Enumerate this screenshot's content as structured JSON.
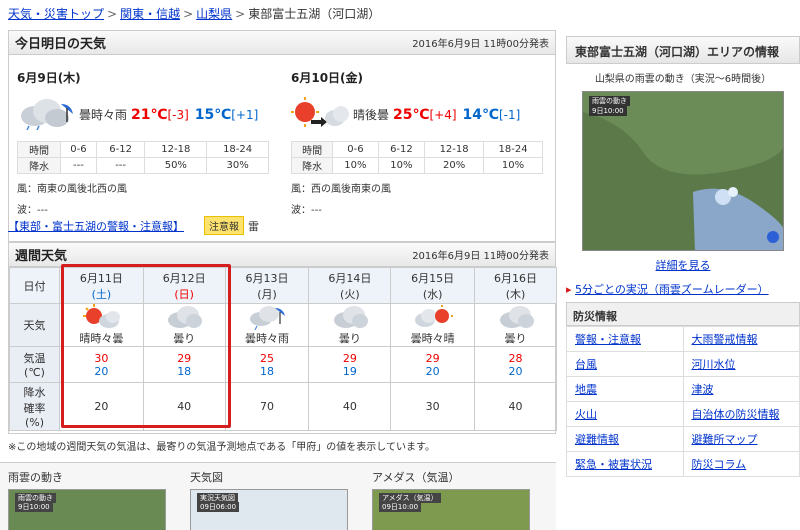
{
  "breadcrumb": {
    "items": [
      "天気・災害トップ",
      "関東・信越",
      "山梨県"
    ],
    "current": "東部富士五湖（河口湖）",
    "sep": ">"
  },
  "today_panel": {
    "title": "今日明日の天気",
    "issued": "2016年6月9日 11時00分発表",
    "days": [
      {
        "date": "6月9日(木)",
        "icon": "rain-cloud-icon",
        "weather": "曇時々雨",
        "high": "21℃",
        "high_diff": "[-3]",
        "low": "15℃",
        "low_diff": "[+1]",
        "rain_labels": [
          "時間",
          "0-6",
          "6-12",
          "12-18",
          "18-24"
        ],
        "rain_values": [
          "降水",
          "---",
          "---",
          "50%",
          "30%"
        ],
        "wind": "風：南東の風後北西の風",
        "wave": "波：---"
      },
      {
        "date": "6月10日(金)",
        "icon": "sun-then-cloud-icon",
        "weather": "晴後曇",
        "high": "25℃",
        "high_diff": "[+4]",
        "low": "14℃",
        "low_diff": "[-1]",
        "rain_labels": [
          "時間",
          "0-6",
          "6-12",
          "12-18",
          "18-24"
        ],
        "rain_values": [
          "降水",
          "10%",
          "10%",
          "20%",
          "10%"
        ],
        "wind": "風：西の風後南東の風",
        "wave": "波：---"
      }
    ],
    "warning_link": "【東部・富士五湖の警報・注意報】",
    "warning_badge": "注意報",
    "warning_type": "雷"
  },
  "weekly": {
    "title": "週間天気",
    "issued": "2016年6月9日 11時00分発表",
    "row_labels": {
      "date": "日付",
      "weather": "天気",
      "temp": "気温\n(℃)",
      "rain": "降水\n確率\n(%)"
    },
    "days": [
      {
        "date": "6月11日",
        "dow": "(土)",
        "dow_class": "sat",
        "icon": "sun-cloud-icon",
        "weather": "晴時々曇",
        "max": "30",
        "min": "20",
        "rain": "20"
      },
      {
        "date": "6月12日",
        "dow": "(日)",
        "dow_class": "sun",
        "icon": "cloud-icon",
        "weather": "曇り",
        "max": "29",
        "min": "18",
        "rain": "40"
      },
      {
        "date": "6月13日",
        "dow": "(月)",
        "dow_class": "wkday",
        "icon": "rain-cloud-icon",
        "weather": "曇時々雨",
        "max": "25",
        "min": "18",
        "rain": "70"
      },
      {
        "date": "6月14日",
        "dow": "(火)",
        "dow_class": "wkday",
        "icon": "cloud-icon",
        "weather": "曇り",
        "max": "29",
        "min": "19",
        "rain": "40"
      },
      {
        "date": "6月15日",
        "dow": "(水)",
        "dow_class": "wkday",
        "icon": "cloud-sun-icon",
        "weather": "曇時々晴",
        "max": "29",
        "min": "20",
        "rain": "30"
      },
      {
        "date": "6月16日",
        "dow": "(木)",
        "dow_class": "wkday",
        "icon": "cloud-icon",
        "weather": "曇り",
        "max": "28",
        "min": "20",
        "rain": "40"
      }
    ],
    "note": "※この地域の週間天気の気温は、最寄りの気温予測地点である「甲府」の値を表示しています。"
  },
  "thumbnails": [
    {
      "label": "雨雲の動き",
      "tag": "雨雲の動き",
      "tag2": "9日10:00"
    },
    {
      "label": "天気図",
      "tag": "実況天気図",
      "tag2": "09日06:00"
    },
    {
      "label": "アメダス（気温）",
      "tag": "アメダス（気温）",
      "tag2": "09日10:00"
    }
  ],
  "right": {
    "area_title": "東部富士五湖（河口湖）エリアの情報",
    "radar_caption": "山梨県の雨雲の動き（実況～6時間後）",
    "radar_tag": "雨雲の動き",
    "radar_time": "9日10:00",
    "detail_link": "詳細を見る",
    "zoom_link": "5分ごとの実況（雨雲ズームレーダー）",
    "bousai_title": "防災情報",
    "bousai_items": [
      [
        "警報・注意報",
        "大雨警戒情報"
      ],
      [
        "台風",
        "河川水位"
      ],
      [
        "地震",
        "津波"
      ],
      [
        "火山",
        "自治体の防災情報"
      ],
      [
        "避難情報",
        "避難所マップ"
      ],
      [
        "緊急・被害状況",
        "防災コラム"
      ]
    ]
  },
  "colors": {
    "high": "#e00000",
    "low": "#0066cc",
    "highlight_box": "#d61d1d",
    "warning_badge": "#fde36e"
  }
}
